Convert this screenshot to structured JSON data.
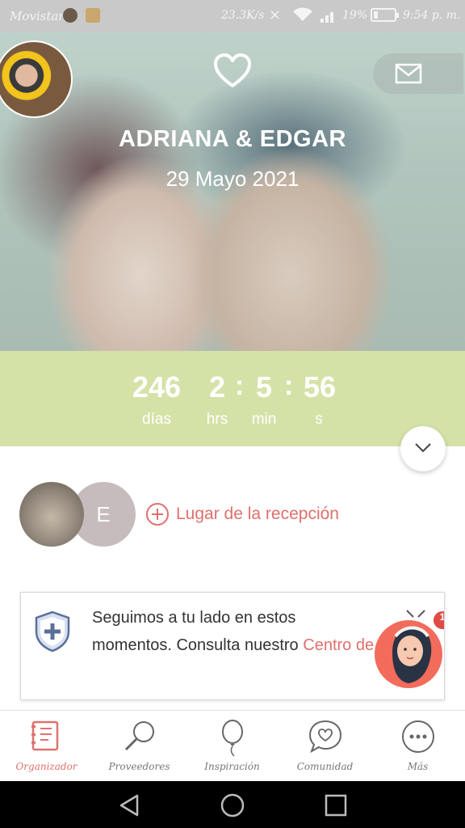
{
  "status_bar": {
    "carrier": "Movistar",
    "speed": "23.3K/s",
    "battery": "19%",
    "time": "9:54 p. m."
  },
  "header": {
    "couple": "ADRIANA & EDGAR",
    "date": "29 Mayo 2021"
  },
  "countdown": {
    "days": "246",
    "days_label": "días",
    "hours": "2",
    "hours_label": "hrs",
    "minutes": "5",
    "minutes_label": "min",
    "seconds": "56",
    "seconds_label": "s",
    "separator": ":"
  },
  "venue": {
    "avatar_initial": "E",
    "add_label": "Lugar de la recepción"
  },
  "help_card": {
    "text_line1": "Seguimos a tu lado en estos",
    "text_line2": "momentos. Consulta nuestro ",
    "link": "Centro de Ayuda",
    "period": "."
  },
  "badge_count": "1",
  "bottom_nav": {
    "items": [
      {
        "label": "Organizador",
        "icon": "organizer-icon",
        "active": true
      },
      {
        "label": "Proveedores",
        "icon": "search-icon",
        "active": false
      },
      {
        "label": "Inspiración",
        "icon": "balloon-icon",
        "active": false
      },
      {
        "label": "Comunidad",
        "icon": "chat-heart-icon",
        "active": false
      },
      {
        "label": "Más",
        "icon": "more-icon",
        "active": false
      }
    ]
  },
  "colors": {
    "accent": "#e0706c",
    "countdown_bg": "#d4e2a8",
    "avatar_bg": "#c6bcbe"
  }
}
